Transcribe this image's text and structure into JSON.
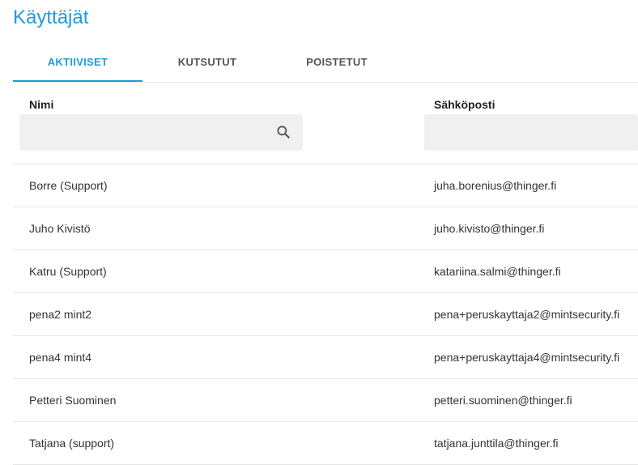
{
  "page": {
    "title": "Käyttäjät"
  },
  "tabs": [
    {
      "label": "AKTIIVISET",
      "active": true
    },
    {
      "label": "KUTSUTUT",
      "active": false
    },
    {
      "label": "POISTETUT",
      "active": false
    }
  ],
  "columns": {
    "name": "Nimi",
    "email": "Sähköposti"
  },
  "filters": {
    "name_value": "",
    "email_value": ""
  },
  "icons": {
    "search": "search-icon"
  },
  "colors": {
    "accent": "#1e9be0",
    "filter_bg": "#f0f0f0"
  },
  "users": [
    {
      "name": "Borre (Support)",
      "email": "juha.borenius@thinger.fi"
    },
    {
      "name": "Juho Kivistö",
      "email": "juho.kivisto@thinger.fi"
    },
    {
      "name": "Katru (Support)",
      "email": "katariina.salmi@thinger.fi"
    },
    {
      "name": "pena2 mint2",
      "email": "pena+peruskayttaja2@mintsecurity.fi"
    },
    {
      "name": "pena4 mint4",
      "email": "pena+peruskayttaja4@mintsecurity.fi"
    },
    {
      "name": "Petteri Suominen",
      "email": "petteri.suominen@thinger.fi"
    },
    {
      "name": "Tatjana (support)",
      "email": "tatjana.junttila@thinger.fi"
    }
  ]
}
